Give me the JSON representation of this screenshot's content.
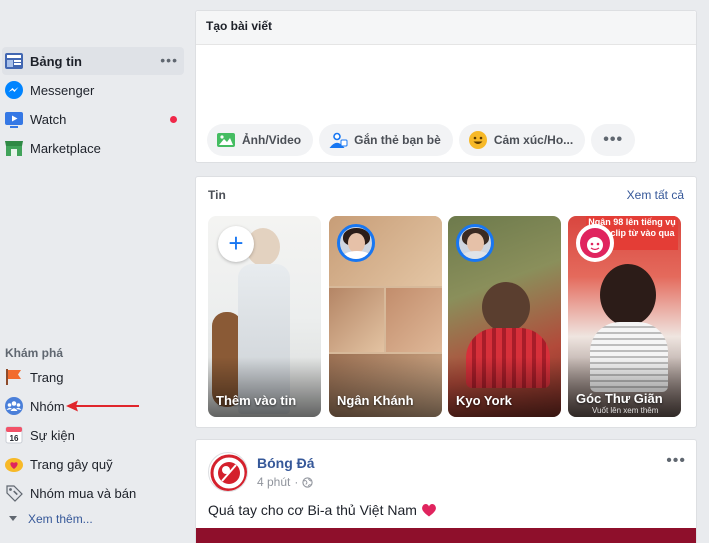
{
  "sidebar": {
    "items": [
      {
        "label": "Bảng tin",
        "icon": "news-feed-icon",
        "active": true
      },
      {
        "label": "Messenger",
        "icon": "messenger-icon"
      },
      {
        "label": "Watch",
        "icon": "watch-icon",
        "notification_dot": true
      },
      {
        "label": "Marketplace",
        "icon": "marketplace-icon"
      }
    ],
    "explore_title": "Khám phá",
    "explore_items": [
      {
        "label": "Trang",
        "icon": "pages-flag-icon"
      },
      {
        "label": "Nhóm",
        "icon": "groups-icon"
      },
      {
        "label": "Sự kiện",
        "icon": "events-calendar-icon",
        "icon_text": "16"
      },
      {
        "label": "Trang gây quỹ",
        "icon": "fundraiser-icon"
      },
      {
        "label": "Nhóm mua và bán",
        "icon": "buy-sell-tag-icon"
      }
    ],
    "see_more": "Xem thêm..."
  },
  "composer": {
    "title": "Tạo bài viết",
    "options": [
      {
        "label": "Ảnh/Video",
        "icon": "photo-video-icon"
      },
      {
        "label": "Gắn thẻ bạn bè",
        "icon": "tag-friends-icon"
      },
      {
        "label": "Cảm xúc/Ho...",
        "icon": "feeling-emoji-icon"
      }
    ]
  },
  "stories": {
    "title": "Tin",
    "see_all": "Xem tất cả",
    "items": [
      {
        "name": "Thêm vào tin"
      },
      {
        "name": "Ngân Khánh"
      },
      {
        "name": "Kyo York"
      },
      {
        "name": "Góc Thư Giãn",
        "banner": "Ngân 98 lên tiếng vụ xùm clip từ vào qua",
        "swipe_hint": "Vuốt lên xem thêm"
      }
    ]
  },
  "post": {
    "author": "Bóng Đá",
    "time": "4 phút",
    "text": "Quá tay cho cơ Bi-a thủ Việt Nam"
  },
  "colors": {
    "background": "#e9ebee",
    "link": "#365899",
    "accent": "#1877f2",
    "notification": "#f02849",
    "annotation_arrow": "#e0252b"
  }
}
